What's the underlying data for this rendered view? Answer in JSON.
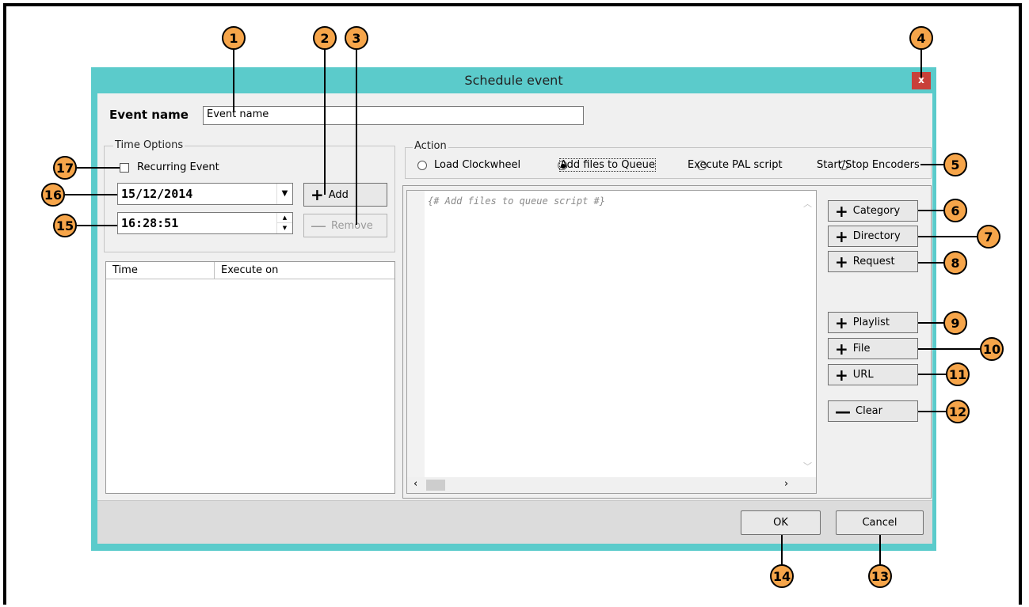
{
  "window": {
    "title": "Schedule event",
    "close_glyph": "x"
  },
  "event_name": {
    "label": "Event name",
    "value": "Event name"
  },
  "time_options": {
    "title": "Time Options",
    "recurring_label": "Recurring Event",
    "date_value": "15/12/2014",
    "time_value": "16:28:51",
    "add_label": "Add",
    "remove_label": "Remove",
    "table_headers": [
      "Time",
      "Execute on"
    ]
  },
  "action": {
    "title": "Action",
    "options": [
      {
        "label": "Load Clockwheel",
        "selected": false
      },
      {
        "label": "Add files to Queue",
        "selected": true
      },
      {
        "label": "Execute PAL script",
        "selected": false
      },
      {
        "label": "Start/Stop Encoders",
        "selected": false
      }
    ]
  },
  "script": {
    "text": "{# Add files to queue script #}"
  },
  "side_buttons": {
    "category": "Category",
    "directory": "Directory",
    "request": "Request",
    "playlist": "Playlist",
    "file": "File",
    "url": "URL",
    "clear": "Clear"
  },
  "footer": {
    "ok": "OK",
    "cancel": "Cancel"
  },
  "callouts": [
    "1",
    "2",
    "3",
    "4",
    "5",
    "6",
    "7",
    "8",
    "9",
    "10",
    "11",
    "12",
    "13",
    "14",
    "15",
    "16",
    "17"
  ],
  "colors": {
    "window_frame": "#5bcbcb",
    "close_button": "#c9403a",
    "callout_fill": "#f6a54a"
  }
}
